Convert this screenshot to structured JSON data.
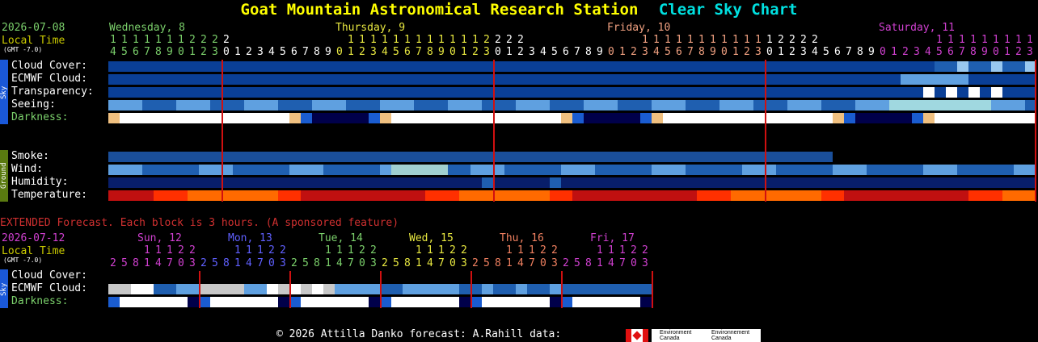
{
  "title": {
    "station": "Goat Mountain Astronomical Research Station",
    "chart": "Clear Sky Chart"
  },
  "header": {
    "date": "2026-07-08",
    "local_time": "Local Time",
    "gmt": "(GMT -7.0)"
  },
  "days": [
    {
      "label": "Wednesday, 8",
      "color": "#7bd06b"
    },
    {
      "label": "Thursday, 9",
      "color": "#e8e840"
    },
    {
      "label": "Friday, 10",
      "color": "#f0a080"
    },
    {
      "label": "Saturday, 11",
      "color": "#d040d0"
    }
  ],
  "hours_tens": "111111122220000000000111111111111222200000000001111111111112222000000000011111111111122220",
  "hours_ones": "456789012301234567890123456789012301234567890123456789012301234567890123456789012345678901",
  "sky_rows": [
    "Cloud Cover:",
    "ECMWF Cloud:",
    "Transparency:",
    "Seeing:",
    "Darkness:"
  ],
  "ground_rows": [
    "Smoke:",
    "Wind:",
    "Humidity:",
    "Temperature:"
  ],
  "sidebar": {
    "sky": "Sky",
    "ground": "Ground"
  },
  "extended": {
    "note": "EXTENDED Forecast. Each block is 3 hours. (A sponsored feature)",
    "date": "2026-07-12",
    "local_time": "Local Time",
    "gmt": "(GMT -7.0)",
    "days": [
      {
        "label": "Sun, 12",
        "color": "#d040d0"
      },
      {
        "label": "Mon, 13",
        "color": "#6060ff"
      },
      {
        "label": "Tue, 14",
        "color": "#7bd06b"
      },
      {
        "label": "Wed, 15",
        "color": "#e8e840"
      },
      {
        "label": "Thu, 16",
        "color": "#f08060"
      },
      {
        "label": "Fri, 17",
        "color": "#d040d0"
      }
    ],
    "hours_tens": "11122",
    "hours_ones": "25814703",
    "rows": [
      "Cloud Cover:",
      "ECMWF Cloud:",
      "Darkness:"
    ]
  },
  "footer": {
    "text": "© 2026 Attilla Danko  forecast: A.Rahill  data:",
    "logo1": "Environment Canada",
    "logo2": "Environnement Canada"
  },
  "colors": {
    "sky_dark": "#003fa0",
    "sky_mid": "#2a6ac0",
    "sky_light": "#6fa8e0",
    "clear_bg": "#1a58b0",
    "red_line": "#d01010"
  }
}
